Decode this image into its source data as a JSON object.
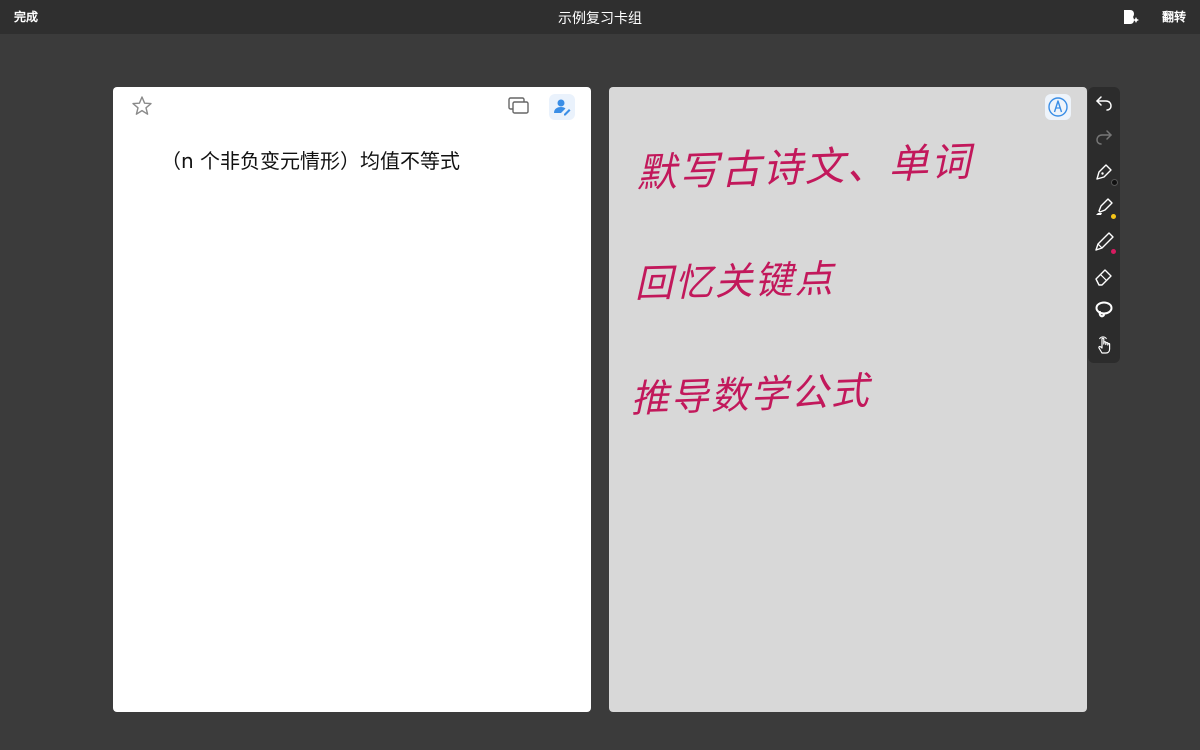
{
  "topbar": {
    "done_label": "完成",
    "title": "示例复习卡组",
    "flip_label": "翻转"
  },
  "front": {
    "question": "（n 个非负变元情形）均值不等式"
  },
  "back": {
    "handwriting": [
      "默写古诗文、单词",
      "回忆关键点",
      "推导数学公式"
    ],
    "ink_color": "#c2185b"
  },
  "toolbar": {
    "tools": [
      "undo-icon",
      "redo-icon",
      "pen-icon",
      "highlighter-icon",
      "pencil-icon",
      "eraser-icon",
      "lasso-icon",
      "hand-touch-icon"
    ],
    "pen_color": "#111111",
    "highlighter_color": "#f5c518",
    "pencil_color": "#d81b60"
  },
  "colors": {
    "background": "#3b3b3b",
    "topbar": "#2f2f2f",
    "accent": "#3a8ee6"
  }
}
